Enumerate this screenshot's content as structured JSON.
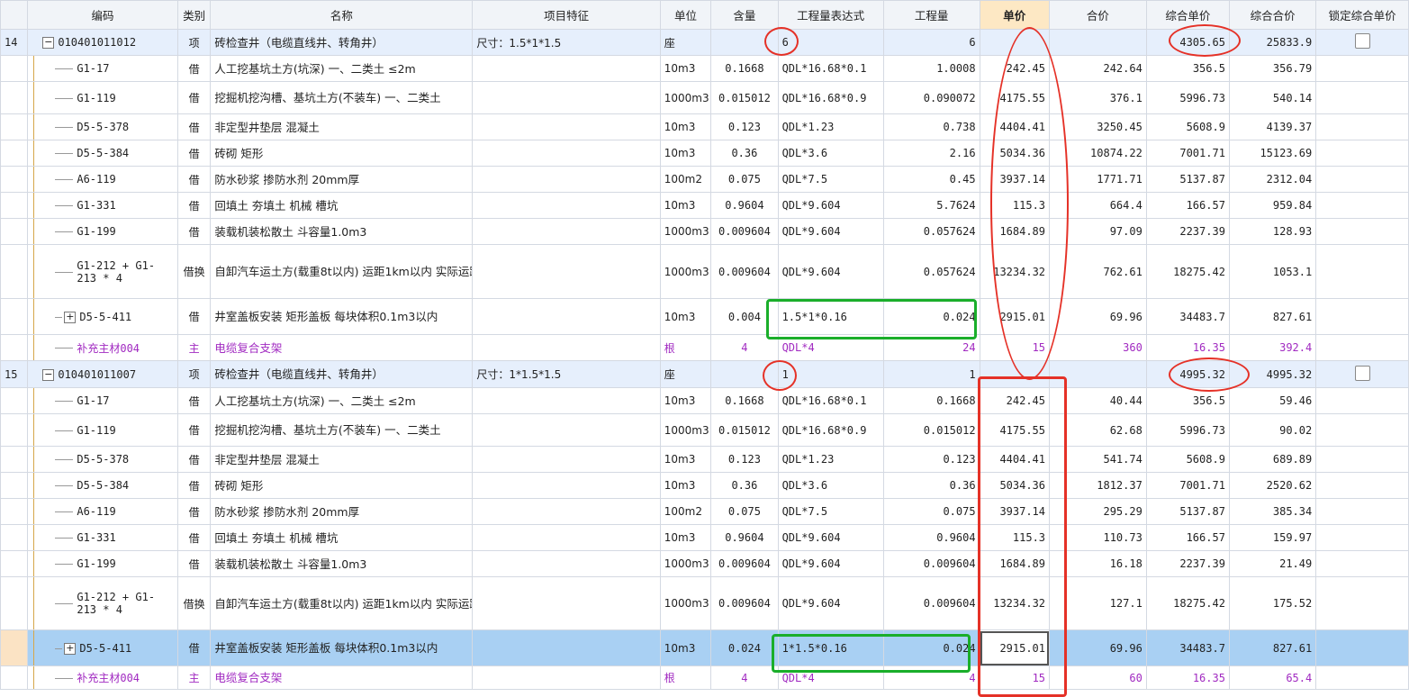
{
  "headers": {
    "rownum": "",
    "code": "编码",
    "category": "类别",
    "name": "名称",
    "feature": "项目特征",
    "unit": "单位",
    "content": "含量",
    "expr": "工程量表达式",
    "qty": "工程量",
    "unit_price": "单价",
    "total_price": "合价",
    "comp_unit_price": "综合单价",
    "comp_total": "综合合价",
    "lock": "锁定综合单价"
  },
  "rows": [
    {
      "rownum": "14",
      "code": "010401011012",
      "category": "项",
      "name": "砖检查井（电缆直线井、转角井）",
      "feature": "尺寸：1.5*1*1.5",
      "unit": "座",
      "content": "",
      "expr": "6",
      "qty": "6",
      "unit_price": "",
      "total_price": "",
      "comp_unit_price": "4305.65",
      "comp_total": "25833.9"
    },
    {
      "rownum": "",
      "code": "G1-17",
      "category": "借",
      "name": "人工挖基坑土方(坑深) 一、二类土 ≤2m",
      "feature": "",
      "unit": "10m3",
      "content": "0.1668",
      "expr": "QDL*16.68*0.1",
      "qty": "1.0008",
      "unit_price": "242.45",
      "total_price": "242.64",
      "comp_unit_price": "356.5",
      "comp_total": "356.79"
    },
    {
      "rownum": "",
      "code": "G1-119",
      "category": "借",
      "name": "挖掘机挖沟槽、基坑土方(不装车) 一、二类土",
      "feature": "",
      "unit": "1000m3",
      "content": "0.015012",
      "expr": "QDL*16.68*0.9",
      "qty": "0.090072",
      "unit_price": "4175.55",
      "total_price": "376.1",
      "comp_unit_price": "5996.73",
      "comp_total": "540.14"
    },
    {
      "rownum": "",
      "code": "D5-5-378",
      "category": "借",
      "name": "非定型井垫层 混凝土",
      "feature": "",
      "unit": "10m3",
      "content": "0.123",
      "expr": "QDL*1.23",
      "qty": "0.738",
      "unit_price": "4404.41",
      "total_price": "3250.45",
      "comp_unit_price": "5608.9",
      "comp_total": "4139.37"
    },
    {
      "rownum": "",
      "code": "D5-5-384",
      "category": "借",
      "name": "砖砌 矩形",
      "feature": "",
      "unit": "10m3",
      "content": "0.36",
      "expr": "QDL*3.6",
      "qty": "2.16",
      "unit_price": "5034.36",
      "total_price": "10874.22",
      "comp_unit_price": "7001.71",
      "comp_total": "15123.69"
    },
    {
      "rownum": "",
      "code": "A6-119",
      "category": "借",
      "name": "防水砂浆 掺防水剂 20mm厚",
      "feature": "",
      "unit": "100m2",
      "content": "0.075",
      "expr": "QDL*7.5",
      "qty": "0.45",
      "unit_price": "3937.14",
      "total_price": "1771.71",
      "comp_unit_price": "5137.87",
      "comp_total": "2312.04"
    },
    {
      "rownum": "",
      "code": "G1-331",
      "category": "借",
      "name": "回填土 夯填土 机械 槽坑",
      "feature": "",
      "unit": "10m3",
      "content": "0.9604",
      "expr": "QDL*9.604",
      "qty": "5.7624",
      "unit_price": "115.3",
      "total_price": "664.4",
      "comp_unit_price": "166.57",
      "comp_total": "959.84"
    },
    {
      "rownum": "",
      "code": "G1-199",
      "category": "借",
      "name": "装载机装松散土 斗容量1.0m3",
      "feature": "",
      "unit": "1000m3",
      "content": "0.009604",
      "expr": "QDL*9.604",
      "qty": "0.057624",
      "unit_price": "1684.89",
      "total_price": "97.09",
      "comp_unit_price": "2237.39",
      "comp_total": "128.93"
    },
    {
      "rownum": "",
      "code": "G1-212 + G1-213 * 4",
      "category": "借换",
      "name": "自卸汽车运土方(载重8t以内) 运距1km以内  实际运距(km)(1km＜s≤30km，超出30km此条填30):5",
      "feature": "",
      "unit": "1000m3",
      "content": "0.009604",
      "expr": "QDL*9.604",
      "qty": "0.057624",
      "unit_price": "13234.32",
      "total_price": "762.61",
      "comp_unit_price": "18275.42",
      "comp_total": "1053.1"
    },
    {
      "rownum": "",
      "code": "D5-5-411",
      "category": "借",
      "name": "井室盖板安装 矩形盖板 每块体积0.1m3以内",
      "feature": "",
      "unit": "10m3",
      "content": "0.004",
      "expr": "1.5*1*0.16",
      "qty": "0.024",
      "unit_price": "2915.01",
      "total_price": "69.96",
      "comp_unit_price": "34483.7",
      "comp_total": "827.61"
    },
    {
      "rownum": "",
      "code": "补充主材004",
      "category": "主",
      "name": "电缆复合支架",
      "feature": "",
      "unit": "根",
      "content": "4",
      "expr": "QDL*4",
      "qty": "24",
      "unit_price": "15",
      "total_price": "360",
      "comp_unit_price": "16.35",
      "comp_total": "392.4"
    },
    {
      "rownum": "15",
      "code": "010401011007",
      "category": "项",
      "name": "砖检查井（电缆直线井、转角井）",
      "feature": "尺寸：1*1.5*1.5",
      "unit": "座",
      "content": "",
      "expr": "1",
      "qty": "1",
      "unit_price": "",
      "total_price": "",
      "comp_unit_price": "4995.32",
      "comp_total": "4995.32"
    },
    {
      "rownum": "",
      "code": "G1-17",
      "category": "借",
      "name": "人工挖基坑土方(坑深) 一、二类土 ≤2m",
      "feature": "",
      "unit": "10m3",
      "content": "0.1668",
      "expr": "QDL*16.68*0.1",
      "qty": "0.1668",
      "unit_price": "242.45",
      "total_price": "40.44",
      "comp_unit_price": "356.5",
      "comp_total": "59.46"
    },
    {
      "rownum": "",
      "code": "G1-119",
      "category": "借",
      "name": "挖掘机挖沟槽、基坑土方(不装车) 一、二类土",
      "feature": "",
      "unit": "1000m3",
      "content": "0.015012",
      "expr": "QDL*16.68*0.9",
      "qty": "0.015012",
      "unit_price": "4175.55",
      "total_price": "62.68",
      "comp_unit_price": "5996.73",
      "comp_total": "90.02"
    },
    {
      "rownum": "",
      "code": "D5-5-378",
      "category": "借",
      "name": "非定型井垫层 混凝土",
      "feature": "",
      "unit": "10m3",
      "content": "0.123",
      "expr": "QDL*1.23",
      "qty": "0.123",
      "unit_price": "4404.41",
      "total_price": "541.74",
      "comp_unit_price": "5608.9",
      "comp_total": "689.89"
    },
    {
      "rownum": "",
      "code": "D5-5-384",
      "category": "借",
      "name": "砖砌 矩形",
      "feature": "",
      "unit": "10m3",
      "content": "0.36",
      "expr": "QDL*3.6",
      "qty": "0.36",
      "unit_price": "5034.36",
      "total_price": "1812.37",
      "comp_unit_price": "7001.71",
      "comp_total": "2520.62"
    },
    {
      "rownum": "",
      "code": "A6-119",
      "category": "借",
      "name": "防水砂浆 掺防水剂 20mm厚",
      "feature": "",
      "unit": "100m2",
      "content": "0.075",
      "expr": "QDL*7.5",
      "qty": "0.075",
      "unit_price": "3937.14",
      "total_price": "295.29",
      "comp_unit_price": "5137.87",
      "comp_total": "385.34"
    },
    {
      "rownum": "",
      "code": "G1-331",
      "category": "借",
      "name": "回填土 夯填土 机械 槽坑",
      "feature": "",
      "unit": "10m3",
      "content": "0.9604",
      "expr": "QDL*9.604",
      "qty": "0.9604",
      "unit_price": "115.3",
      "total_price": "110.73",
      "comp_unit_price": "166.57",
      "comp_total": "159.97"
    },
    {
      "rownum": "",
      "code": "G1-199",
      "category": "借",
      "name": "装载机装松散土 斗容量1.0m3",
      "feature": "",
      "unit": "1000m3",
      "content": "0.009604",
      "expr": "QDL*9.604",
      "qty": "0.009604",
      "unit_price": "1684.89",
      "total_price": "16.18",
      "comp_unit_price": "2237.39",
      "comp_total": "21.49"
    },
    {
      "rownum": "",
      "code": "G1-212 + G1-213 * 4",
      "category": "借换",
      "name": "自卸汽车运土方(载重8t以内) 运距1km以内  实际运距(km)(1km＜s≤30km，超出30km此条填30):5",
      "feature": "",
      "unit": "1000m3",
      "content": "0.009604",
      "expr": "QDL*9.604",
      "qty": "0.009604",
      "unit_price": "13234.32",
      "total_price": "127.1",
      "comp_unit_price": "18275.42",
      "comp_total": "175.52"
    },
    {
      "rownum": "",
      "code": "D5-5-411",
      "category": "借",
      "name": "井室盖板安装 矩形盖板 每块体积0.1m3以内",
      "feature": "",
      "unit": "10m3",
      "content": "0.024",
      "expr": "1*1.5*0.16",
      "qty": "0.024",
      "unit_price": "2915.01",
      "total_price": "69.96",
      "comp_unit_price": "34483.7",
      "comp_total": "827.61"
    },
    {
      "rownum": "",
      "code": "补充主材004",
      "category": "主",
      "name": "电缆复合支架",
      "feature": "",
      "unit": "根",
      "content": "4",
      "expr": "QDL*4",
      "qty": "4",
      "unit_price": "15",
      "total_price": "60",
      "comp_unit_price": "16.35",
      "comp_total": "65.4"
    }
  ],
  "colors": {
    "annotation_red": "#e53127",
    "annotation_green": "#1aae2a",
    "material_text": "#a12ac1",
    "selected_row": "#a9d0f3",
    "item_row": "#e6effc",
    "unit_price_header": "#fde8c4"
  }
}
